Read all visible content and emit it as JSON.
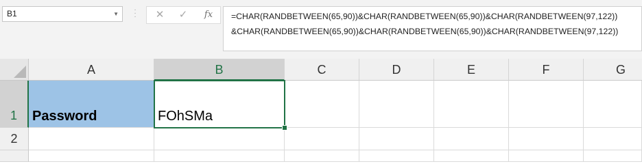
{
  "formula_bar": {
    "name_box": "B1",
    "formula_line1": "=CHAR(RANDBETWEEN(65,90))&CHAR(RANDBETWEEN(65,90))&CHAR(RANDBETWEEN(97,122))",
    "formula_line2": "&CHAR(RANDBETWEEN(65,90))&CHAR(RANDBETWEEN(65,90))&CHAR(RANDBETWEEN(97,122))",
    "icons": [
      "cancel-icon",
      "enter-icon",
      "fx-icon"
    ]
  },
  "grid": {
    "columns": [
      "A",
      "B",
      "C",
      "D",
      "E",
      "F",
      "G"
    ],
    "selected_column": "B",
    "rows": [
      "1",
      "2"
    ],
    "cells": {
      "A1": "Password",
      "B1": "FOhSMa"
    },
    "active_cell": "B1",
    "colors": {
      "a1_fill": "#9dc3e6",
      "selection": "#217346"
    }
  }
}
